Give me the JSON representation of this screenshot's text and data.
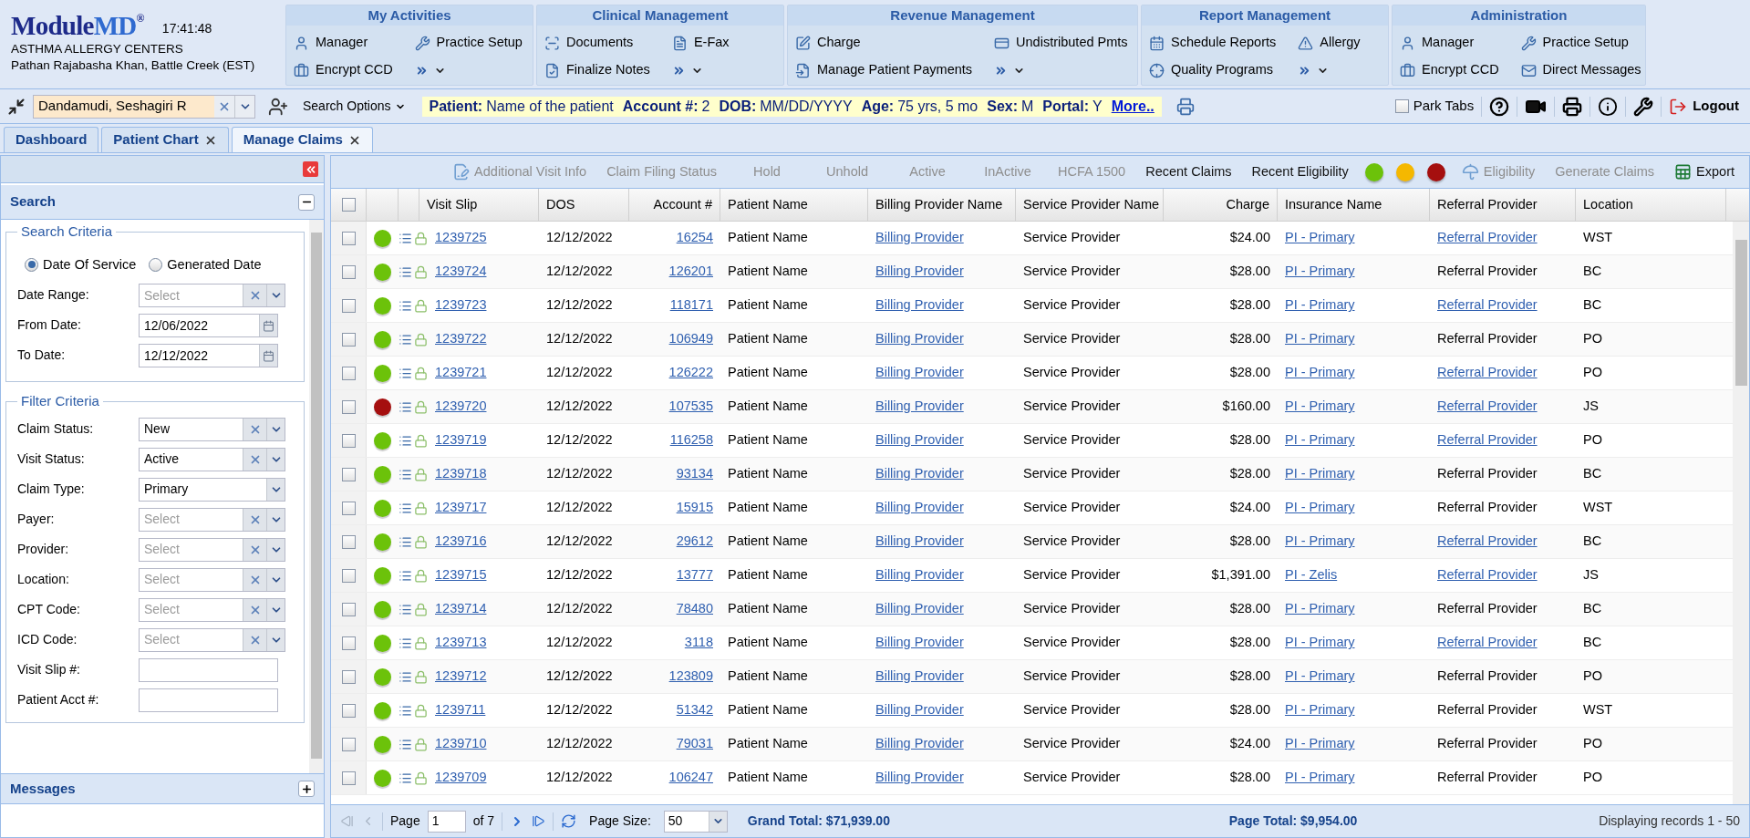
{
  "header": {
    "logo": {
      "part_1": "Module",
      "part_2": "MD",
      "mark": "®"
    },
    "time": "17:41:48",
    "org": "ASTHMA ALLERGY CENTERS",
    "user": "Pathan Rajabasha Khan, Battle Creek (EST)"
  },
  "menu_groups": [
    {
      "title": "My Activities",
      "items": [
        "Manager",
        "Practice Setup",
        "Encrypt CCD"
      ],
      "more": true
    },
    {
      "title": "Clinical Management",
      "items": [
        "Documents",
        "E-Fax",
        "Finalize Notes"
      ],
      "more": true
    },
    {
      "title": "Revenue Management",
      "items": [
        "Charge",
        "Undistributed Pmts",
        "Manage Patient Payments"
      ],
      "more": true
    },
    {
      "title": "Report Management",
      "items": [
        "Schedule Reports",
        "Allergy",
        "Quality Programs"
      ],
      "more": true
    },
    {
      "title": "Administration",
      "items": [
        "Manager",
        "Practice Setup",
        "Encrypt CCD",
        "Direct Messages"
      ],
      "more": false
    }
  ],
  "patient_bar": {
    "search": {
      "value": "Dandamudi, Seshagiri R"
    },
    "search_options": "Search Options",
    "patient_info": [
      {
        "label": "Patient:",
        "value": "Name of the patient"
      },
      {
        "label": "Account #:",
        "value": "2"
      },
      {
        "label": "DOB:",
        "value": "MM/DD/YYYY"
      },
      {
        "label": "Age:",
        "value": "75 yrs, 5 mo"
      },
      {
        "label": "Sex:",
        "value": "M"
      },
      {
        "label": "Portal:",
        "value": "Y"
      }
    ],
    "more_link": "More..",
    "park_tabs": {
      "label": "Park Tabs",
      "checked": false
    },
    "logout": "Logout"
  },
  "tabs": [
    {
      "label": "Dashboard",
      "closable": false,
      "selected": false
    },
    {
      "label": "Patient Chart",
      "closable": true,
      "selected": false
    },
    {
      "label": "Manage Claims",
      "closable": true,
      "selected": true
    }
  ],
  "search_panel": {
    "title": "Search",
    "expanded": true,
    "search_criteria": {
      "legend": "Search Criteria",
      "date_options": [
        {
          "label": "Date Of Service",
          "selected": true
        },
        {
          "label": "Generated Date",
          "selected": false
        }
      ],
      "fields": [
        {
          "label": "Date Range:",
          "kind": "combo",
          "placeholder": "Select"
        },
        {
          "label": "From Date:",
          "kind": "date",
          "value": "12/06/2022"
        },
        {
          "label": "To Date:",
          "kind": "date",
          "value": "12/12/2022"
        }
      ]
    },
    "filter_criteria": {
      "legend": "Filter Criteria",
      "fields": [
        {
          "label": "Claim Status:",
          "kind": "combo",
          "value": "New"
        },
        {
          "label": "Visit Status:",
          "kind": "combo",
          "value": "Active"
        },
        {
          "label": "Claim Type:",
          "kind": "select",
          "value": "Primary"
        },
        {
          "label": "Payer:",
          "kind": "combo",
          "placeholder": "Select"
        },
        {
          "label": "Provider:",
          "kind": "combo",
          "placeholder": "Select"
        },
        {
          "label": "Location:",
          "kind": "combo",
          "placeholder": "Select"
        },
        {
          "label": "CPT Code:",
          "kind": "combo",
          "placeholder": "Select"
        },
        {
          "label": "ICD Code:",
          "kind": "combo",
          "placeholder": "Select"
        },
        {
          "label": "Visit Slip #:",
          "kind": "text"
        },
        {
          "label": "Patient Acct #:",
          "kind": "text"
        }
      ]
    }
  },
  "messages_panel": {
    "title": "Messages",
    "expanded": false
  },
  "toolbar": [
    {
      "kind": "button",
      "label": "Additional Visit Info",
      "disabled": true
    },
    {
      "kind": "button",
      "label": "Claim Filing Status",
      "disabled": true
    },
    {
      "kind": "button",
      "label": "Hold",
      "disabled": true
    },
    {
      "kind": "button",
      "label": "Unhold",
      "disabled": true
    },
    {
      "kind": "button",
      "label": "Active",
      "disabled": true
    },
    {
      "kind": "button",
      "label": "InActive",
      "disabled": true
    },
    {
      "kind": "button",
      "label": "HCFA 1500",
      "disabled": true
    },
    {
      "kind": "button",
      "label": "Recent Claims",
      "disabled": false
    },
    {
      "kind": "button",
      "label": "Recent Eligibility",
      "disabled": false
    },
    {
      "kind": "dot",
      "color": "#6cc20a"
    },
    {
      "kind": "dot",
      "color": "#f5b800"
    },
    {
      "kind": "dot",
      "color": "#a50f0f"
    },
    {
      "kind": "button",
      "label": "Eligibility",
      "disabled": true
    },
    {
      "kind": "button",
      "label": "Generate Claims",
      "disabled": true
    },
    {
      "kind": "button",
      "label": "Export",
      "disabled": false
    }
  ],
  "table": {
    "select_all": {
      "checked": false
    },
    "columns": [
      "Visit Slip",
      "DOS",
      "Account #",
      "Patient Name",
      "Billing Provider Name",
      "Service Provider Name",
      "Charge",
      "Insurance Name",
      "Referral Provider",
      "Location"
    ],
    "rows": [
      {
        "checked": false,
        "color": "#6cc20a",
        "visit_slip": "1239725",
        "dos": "12/12/2022",
        "account": "16254",
        "patient_name": "Patient Name",
        "billing_provider": "Billing Provider",
        "service_provider": "Service Provider",
        "charge": "$24.00",
        "insurance": "PI - Primary",
        "referral_provider": "Referral Provider",
        "referral_linked": true,
        "location": "WST"
      },
      {
        "checked": false,
        "color": "#6cc20a",
        "visit_slip": "1239724",
        "dos": "12/12/2022",
        "account": "126201",
        "patient_name": "Patient Name",
        "billing_provider": "Billing Provider",
        "service_provider": "Service Provider",
        "charge": "$28.00",
        "insurance": "PI - Primary",
        "referral_provider": "Referral Provider",
        "referral_linked": false,
        "location": "BC"
      },
      {
        "checked": false,
        "color": "#6cc20a",
        "visit_slip": "1239723",
        "dos": "12/12/2022",
        "account": "118171",
        "patient_name": "Patient Name",
        "billing_provider": "Billing Provider",
        "service_provider": "Service Provider",
        "charge": "$28.00",
        "insurance": "PI - Primary",
        "referral_provider": "Referral Provider",
        "referral_linked": true,
        "location": "BC"
      },
      {
        "checked": false,
        "color": "#6cc20a",
        "visit_slip": "1239722",
        "dos": "12/12/2022",
        "account": "106949",
        "patient_name": "Patient Name",
        "billing_provider": "Billing Provider",
        "service_provider": "Service Provider",
        "charge": "$28.00",
        "insurance": "PI - Primary",
        "referral_provider": "Referral Provider",
        "referral_linked": false,
        "location": "PO"
      },
      {
        "checked": false,
        "color": "#6cc20a",
        "visit_slip": "1239721",
        "dos": "12/12/2022",
        "account": "126222",
        "patient_name": "Patient Name",
        "billing_provider": "Billing Provider",
        "service_provider": "Service Provider",
        "charge": "$28.00",
        "insurance": "PI - Primary",
        "referral_provider": "Referral Provider",
        "referral_linked": true,
        "location": "PO"
      },
      {
        "checked": false,
        "color": "#a50f0f",
        "visit_slip": "1239720",
        "dos": "12/12/2022",
        "account": "107535",
        "patient_name": "Patient Name",
        "billing_provider": "Billing Provider",
        "service_provider": "Service Provider",
        "charge": "$160.00",
        "insurance": "PI - Primary",
        "referral_provider": "Referral Provider",
        "referral_linked": true,
        "location": "JS"
      },
      {
        "checked": false,
        "color": "#6cc20a",
        "visit_slip": "1239719",
        "dos": "12/12/2022",
        "account": "116258",
        "patient_name": "Patient Name",
        "billing_provider": "Billing Provider",
        "service_provider": "Service Provider",
        "charge": "$28.00",
        "insurance": "PI - Primary",
        "referral_provider": "Referral Provider",
        "referral_linked": true,
        "location": "PO"
      },
      {
        "checked": false,
        "color": "#6cc20a",
        "visit_slip": "1239718",
        "dos": "12/12/2022",
        "account": "93134",
        "patient_name": "Patient Name",
        "billing_provider": "Billing Provider",
        "service_provider": "Service Provider",
        "charge": "$28.00",
        "insurance": "PI - Primary",
        "referral_provider": "Referral Provider",
        "referral_linked": false,
        "location": "BC"
      },
      {
        "checked": false,
        "color": "#6cc20a",
        "visit_slip": "1239717",
        "dos": "12/12/2022",
        "account": "15915",
        "patient_name": "Patient Name",
        "billing_provider": "Billing Provider",
        "service_provider": "Service Provider",
        "charge": "$24.00",
        "insurance": "PI - Primary",
        "referral_provider": "Referral Provider",
        "referral_linked": false,
        "location": "WST"
      },
      {
        "checked": false,
        "color": "#6cc20a",
        "visit_slip": "1239716",
        "dos": "12/12/2022",
        "account": "29612",
        "patient_name": "Patient Name",
        "billing_provider": "Billing Provider",
        "service_provider": "Service Provider",
        "charge": "$28.00",
        "insurance": "PI - Primary",
        "referral_provider": "Referral Provider",
        "referral_linked": true,
        "location": "BC"
      },
      {
        "checked": false,
        "color": "#6cc20a",
        "visit_slip": "1239715",
        "dos": "12/12/2022",
        "account": "13777",
        "patient_name": "Patient Name",
        "billing_provider": "Billing Provider",
        "service_provider": "Service Provider",
        "charge": "$1,391.00",
        "insurance": "PI - Zelis",
        "referral_provider": "Referral Provider",
        "referral_linked": true,
        "location": "JS"
      },
      {
        "checked": false,
        "color": "#6cc20a",
        "visit_slip": "1239714",
        "dos": "12/12/2022",
        "account": "78480",
        "patient_name": "Patient Name",
        "billing_provider": "Billing Provider",
        "service_provider": "Service Provider",
        "charge": "$28.00",
        "insurance": "PI - Primary",
        "referral_provider": "Referral Provider",
        "referral_linked": false,
        "location": "BC"
      },
      {
        "checked": false,
        "color": "#6cc20a",
        "visit_slip": "1239713",
        "dos": "12/12/2022",
        "account": "3118",
        "patient_name": "Patient Name",
        "billing_provider": "Billing Provider",
        "service_provider": "Service Provider",
        "charge": "$28.00",
        "insurance": "PI - Primary",
        "referral_provider": "Referral Provider",
        "referral_linked": true,
        "location": "BC"
      },
      {
        "checked": false,
        "color": "#6cc20a",
        "visit_slip": "1239712",
        "dos": "12/12/2022",
        "account": "123809",
        "patient_name": "Patient Name",
        "billing_provider": "Billing Provider",
        "service_provider": "Service Provider",
        "charge": "$28.00",
        "insurance": "PI - Primary",
        "referral_provider": "Referral Provider",
        "referral_linked": false,
        "location": "PO"
      },
      {
        "checked": false,
        "color": "#6cc20a",
        "visit_slip": "1239711",
        "dos": "12/12/2022",
        "account": "51342",
        "patient_name": "Patient Name",
        "billing_provider": "Billing Provider",
        "service_provider": "Service Provider",
        "charge": "$28.00",
        "insurance": "PI - Primary",
        "referral_provider": "Referral Provider",
        "referral_linked": false,
        "location": "WST"
      },
      {
        "checked": false,
        "color": "#6cc20a",
        "visit_slip": "1239710",
        "dos": "12/12/2022",
        "account": "79031",
        "patient_name": "Patient Name",
        "billing_provider": "Billing Provider",
        "service_provider": "Service Provider",
        "charge": "$24.00",
        "insurance": "PI - Primary",
        "referral_provider": "Referral Provider",
        "referral_linked": false,
        "location": "PO"
      },
      {
        "checked": false,
        "color": "#6cc20a",
        "visit_slip": "1239709",
        "dos": "12/12/2022",
        "account": "106247",
        "patient_name": "Patient Name",
        "billing_provider": "Billing Provider",
        "service_provider": "Service Provider",
        "charge": "$28.00",
        "insurance": "PI - Primary",
        "referral_provider": "Referral Provider",
        "referral_linked": false,
        "location": "PO"
      }
    ]
  },
  "pager": {
    "page_label": "Page",
    "page": "1",
    "page_of": "of 7",
    "page_size_label": "Page Size:",
    "page_size": "50",
    "grand_total": "Grand Total: $71,939.00",
    "page_total": "Page Total: $9,954.00",
    "display": "Displaying records 1 - 50"
  }
}
